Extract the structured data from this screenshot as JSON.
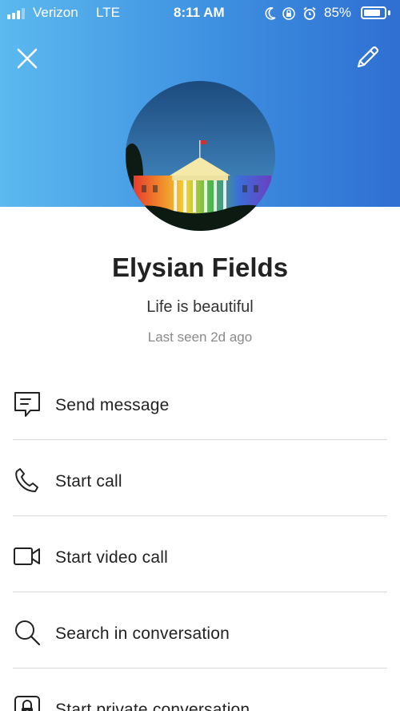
{
  "status_bar": {
    "carrier": "Verizon",
    "network": "LTE",
    "time": "8:11 AM",
    "battery_percent": "85%",
    "battery_level": 0.85,
    "signal_bars": 3,
    "icons": [
      "moon-icon",
      "orientation-lock-icon",
      "alarm-icon"
    ]
  },
  "header": {
    "close_icon": "close-icon",
    "edit_icon": "pencil-icon",
    "gradient": [
      "#5cb9ef",
      "#2f6fd2"
    ]
  },
  "profile": {
    "name": "Elysian Fields",
    "mood": "Life is beautiful",
    "last_seen": "Last seen 2d ago"
  },
  "actions": [
    {
      "label": "Send message",
      "icon": "message-icon"
    },
    {
      "label": "Start call",
      "icon": "phone-icon"
    },
    {
      "label": "Start video call",
      "icon": "video-camera-icon"
    },
    {
      "label": "Search in conversation",
      "icon": "search-icon"
    },
    {
      "label": "Start private conversation",
      "icon": "lock-icon"
    }
  ]
}
